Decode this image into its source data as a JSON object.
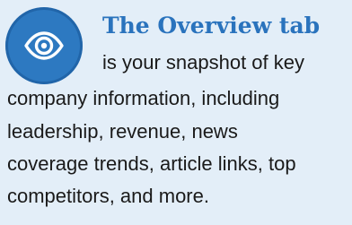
{
  "card": {
    "title": "The Overview tab",
    "lines": [
      "is your snapshot of key",
      "company information, including",
      "leadership, revenue, news",
      "coverage trends, article links, top",
      "competitors, and more."
    ],
    "icon": "eye-icon",
    "colors": {
      "background": "#e3eef8",
      "accent": "#2a73bd",
      "icon_circle": "#2d79c1",
      "text": "#1a1a1a"
    }
  }
}
